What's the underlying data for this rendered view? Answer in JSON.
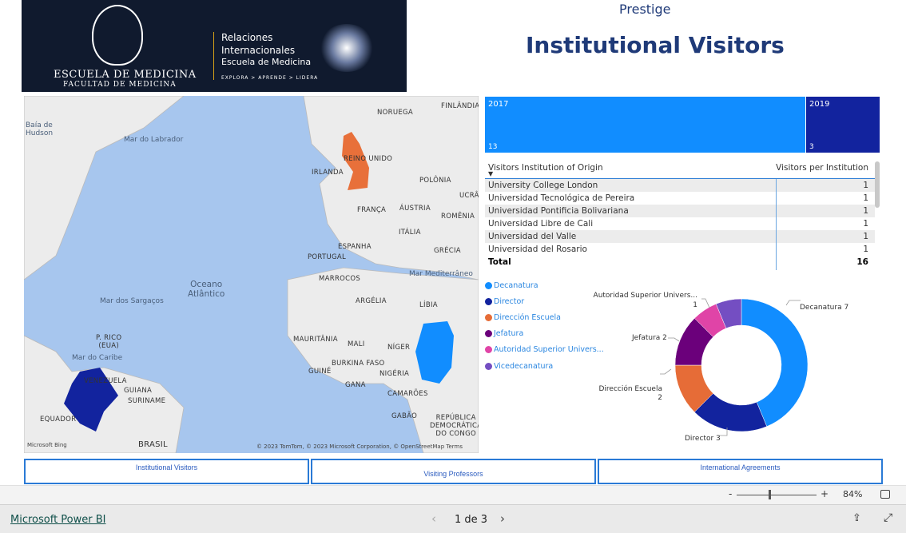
{
  "logo": {
    "school": "ESCUELA DE MEDICINA",
    "faculty": "FACULTAD DE MEDICINA",
    "line1": "Relaciones",
    "line2": "Internacionales",
    "line3": "Escuela de Medicina",
    "tagline": "EXPLORA > APRENDE > LIDERA"
  },
  "header": {
    "subtitle": "Prestige",
    "title": "Institutional Visitors"
  },
  "map": {
    "labels": {
      "baffin": "Baía de\nHudson",
      "labrador": "Mar do Labrador",
      "finland": "FINLÂNDIA",
      "norway": "NORUEGA",
      "uk": "REINO UNIDO",
      "ireland": "IRLANDA",
      "poland": "POLÔNIA",
      "ukraine": "UCRÂNIA",
      "france": "FRANÇA",
      "austria": "ÁUSTRIA",
      "romania": "ROMÊNIA",
      "italy": "ITÁLIA",
      "spain": "ESPANHA",
      "portugal": "PORTUGAL",
      "greece": "GRÉCIA",
      "med": "Mar Mediterrâneo",
      "morocco": "MARROCOS",
      "algeria": "ARGÉLIA",
      "libya": "LÍBIA",
      "ocean": "Oceano\nAtlântico",
      "sargasso": "Mar dos Sargaços",
      "mauritania": "MAURITÂNIA",
      "mali": "MALI",
      "niger": "NÍGER",
      "caribbean": "Mar do Caribe",
      "pr": "P. RICO\n(EUA)",
      "burkina": "BURKINA FASO",
      "guinea": "GUINÉ",
      "nigeria": "NIGÉRIA",
      "venezuela": "VENEZUELA",
      "guyana": "GUIANA",
      "suriname": "SURINAME",
      "ghana": "GANA",
      "cameroon": "CAMARÕES",
      "gabon": "GABÃO",
      "ecuador": "EQUADOR",
      "brazil": "BRASIL",
      "car": "REPÚBLICA\nDEMOCRÁTICA\nDO CONGO"
    },
    "highlighted": [
      {
        "country": "United Kingdom",
        "color": "#e8703a"
      },
      {
        "country": "Colombia",
        "color": "#1a2aa0"
      },
      {
        "country": "Chad",
        "color": "#118dff"
      }
    ],
    "bing": "Microsoft Bing",
    "copyright": "© 2023 TomTom, © 2023 Microsoft Corporation, © OpenStreetMap  Terms"
  },
  "treemap": [
    {
      "year": "2017",
      "value": 13,
      "color": "#118dff"
    },
    {
      "year": "2019",
      "value": 3,
      "color": "#12239e"
    }
  ],
  "table": {
    "headers": [
      "Visitors Institution of Origin",
      "Visitors per Institution"
    ],
    "rows": [
      [
        "University College London",
        "1"
      ],
      [
        "Universidad Tecnológica de Pereira",
        "1"
      ],
      [
        "Universidad Pontificia Bolivariana",
        "1"
      ],
      [
        "Universidad Libre de Cali",
        "1"
      ],
      [
        "Universidad del Valle",
        "1"
      ],
      [
        "Universidad del Rosario",
        "1"
      ]
    ],
    "total_label": "Total",
    "total": "16"
  },
  "chart_data": {
    "type": "pie",
    "donut": true,
    "legend": [
      "Decanatura",
      "Director",
      "Dirección Escuela",
      "Jefatura",
      "Autoridad Superior Univers...",
      "Vicedecanatura"
    ],
    "categories": [
      "Decanatura",
      "Director",
      "Dirección Escuela",
      "Jefatura",
      "Autoridad Superior Univers...",
      "Vicedecanatura"
    ],
    "values": [
      7,
      3,
      2,
      2,
      1,
      1
    ],
    "colors": [
      "#118dff",
      "#12239e",
      "#e66c37",
      "#6b007b",
      "#e044a7",
      "#744ec2"
    ],
    "data_labels": [
      "Decanatura 7",
      "Director 3",
      "Dirección Escuela\n2",
      "Jefatura 2",
      "Autoridad Superior Univers...\n1"
    ],
    "legend_position": "left"
  },
  "nav": {
    "buttons": [
      "Institutional Visitors",
      "Visiting Professors",
      "International Agreements"
    ]
  },
  "zoom": {
    "minus": "-",
    "plus": "+",
    "level": "84%",
    "value": 84
  },
  "footer": {
    "brand": "Microsoft Power BI",
    "page": "1 de 3",
    "prev": "‹",
    "next": "›"
  }
}
